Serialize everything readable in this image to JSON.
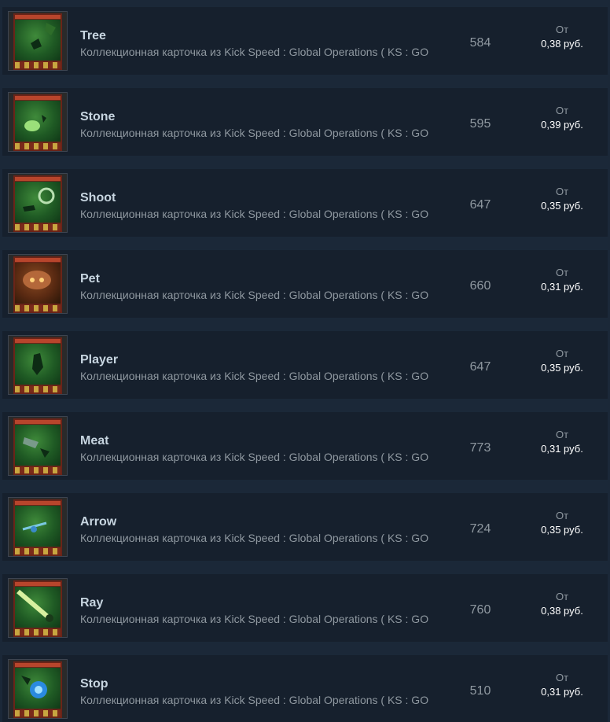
{
  "listings": [
    {
      "name": "Tree",
      "game": "Коллекционная карточка из Kick Speed : Global Operations ( KS : GO",
      "quantity": "584",
      "price_from": "От",
      "price": "0,38 руб.",
      "art_icon": "tree-art-icon"
    },
    {
      "name": "Stone",
      "game": "Коллекционная карточка из Kick Speed : Global Operations ( KS : GO",
      "quantity": "595",
      "price_from": "От",
      "price": "0,39 руб.",
      "art_icon": "stone-art-icon"
    },
    {
      "name": "Shoot",
      "game": "Коллекционная карточка из Kick Speed : Global Operations ( KS : GO",
      "quantity": "647",
      "price_from": "От",
      "price": "0,35 руб.",
      "art_icon": "shoot-art-icon"
    },
    {
      "name": "Pet",
      "game": "Коллекционная карточка из Kick Speed : Global Operations ( KS : GO",
      "quantity": "660",
      "price_from": "От",
      "price": "0,31 руб.",
      "art_icon": "pet-art-icon"
    },
    {
      "name": "Player",
      "game": "Коллекционная карточка из Kick Speed : Global Operations ( KS : GO",
      "quantity": "647",
      "price_from": "От",
      "price": "0,35 руб.",
      "art_icon": "player-art-icon"
    },
    {
      "name": "Meat",
      "game": "Коллекционная карточка из Kick Speed : Global Operations ( KS : GO",
      "quantity": "773",
      "price_from": "От",
      "price": "0,31 руб.",
      "art_icon": "meat-art-icon"
    },
    {
      "name": "Arrow",
      "game": "Коллекционная карточка из Kick Speed : Global Operations ( KS : GO",
      "quantity": "724",
      "price_from": "От",
      "price": "0,35 руб.",
      "art_icon": "arrow-art-icon"
    },
    {
      "name": "Ray",
      "game": "Коллекционная карточка из Kick Speed : Global Operations ( KS : GO",
      "quantity": "760",
      "price_from": "От",
      "price": "0,38 руб.",
      "art_icon": "ray-art-icon"
    },
    {
      "name": "Stop",
      "game": "Коллекционная карточка из Kick Speed : Global Operations ( KS : GO",
      "quantity": "510",
      "price_from": "От",
      "price": "0,31 руб.",
      "art_icon": "stop-art-icon"
    }
  ],
  "colors": {
    "page_background": "#1b2838",
    "row_background": "#16202d",
    "name_text": "#c7d5e0",
    "secondary_text": "#8f98a0",
    "price_text": "#ffffff"
  }
}
